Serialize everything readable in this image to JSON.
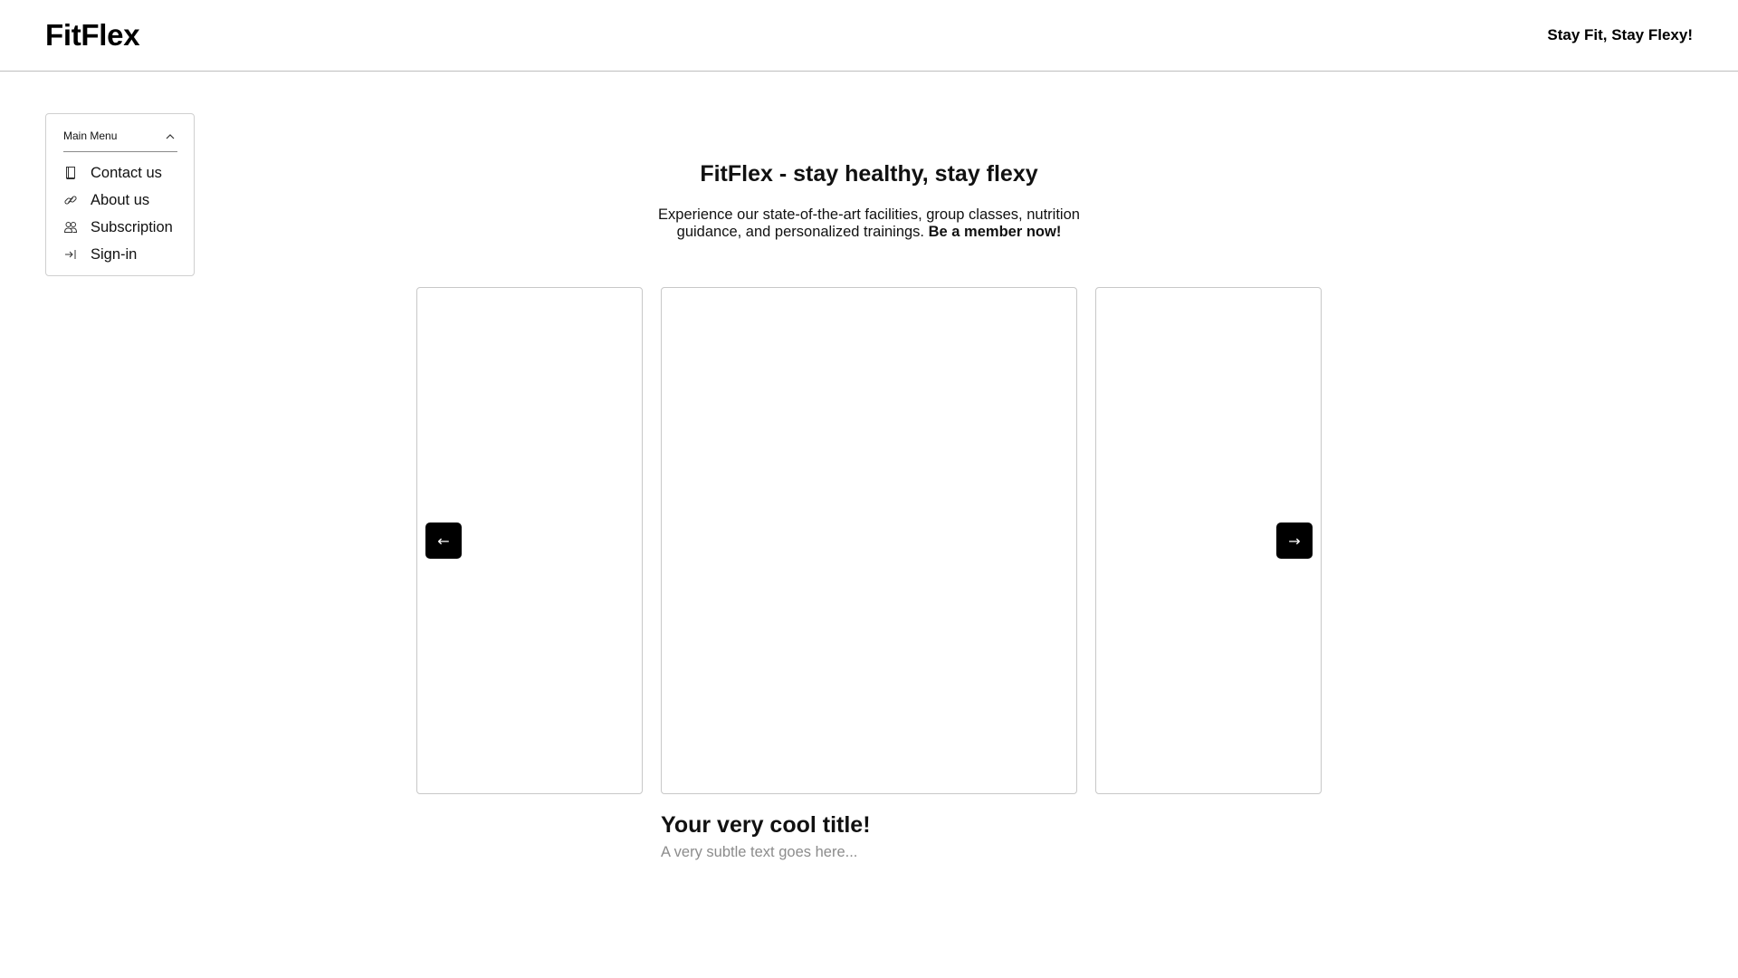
{
  "header": {
    "logo": "FitFlex",
    "tagline": "Stay Fit, Stay Flexy!"
  },
  "menu": {
    "title": "Main Menu",
    "items": [
      {
        "label": "Contact us",
        "icon": "book-icon"
      },
      {
        "label": "About us",
        "icon": "link-icon"
      },
      {
        "label": "Subscription",
        "icon": "users-icon"
      },
      {
        "label": "Sign-in",
        "icon": "sign-in-icon"
      }
    ]
  },
  "hero": {
    "brand": "FitFlex",
    "title_rest": " - stay healthy, stay flexy",
    "subtitle": "Experience our state-of-the-art facilities, group classes, nutrition guidance, and personalized trainings. ",
    "cta": "Be a member now!"
  },
  "carousel": {
    "prev_symbol": "←",
    "next_symbol": "→",
    "slide_title": "Your very cool title!",
    "slide_subtitle": "A very subtle text goes here..."
  },
  "colors": {
    "accent": "#000000",
    "muted_text": "#8c8c8c",
    "border": "#c8c8c8"
  }
}
